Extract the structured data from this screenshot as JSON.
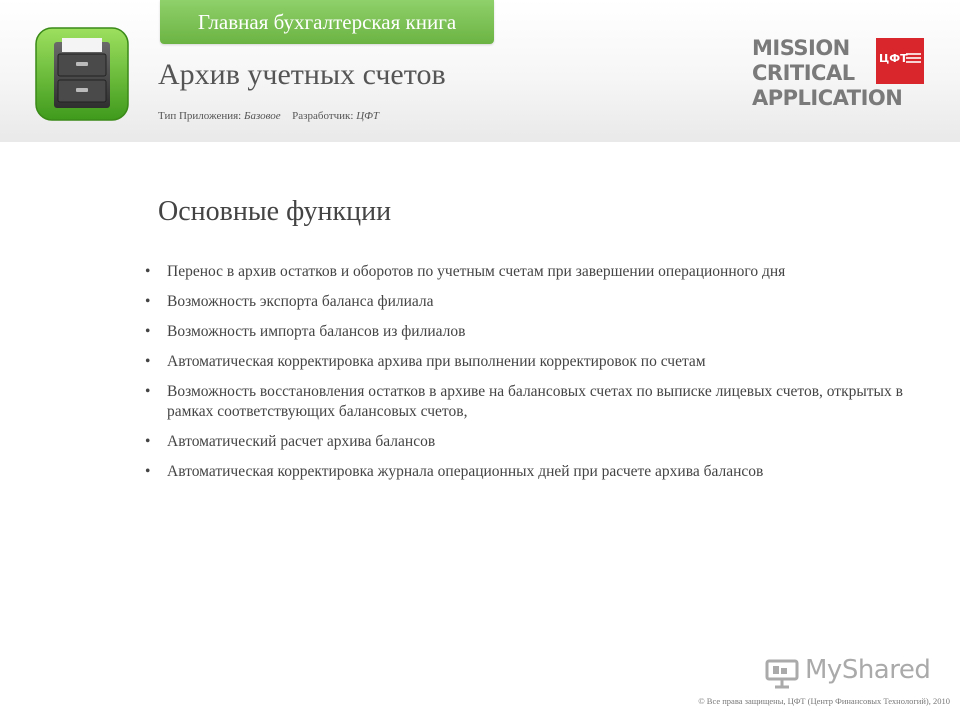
{
  "header": {
    "category_tab": "Главная бухгалтерская книга",
    "app_title": "Архив учетных счетов",
    "meta": {
      "type_label": "Тип Приложения:",
      "type_value": "Базовое",
      "developer_label": "Разработчик:",
      "developer_value": "ЦФТ"
    },
    "brand": {
      "line1": "MISSION",
      "line2": "CRITICAL",
      "line3": "APPLICATION",
      "logo_abbr": "ЦФТ",
      "logo_color": "#d9262c"
    },
    "accent_color": "#6bb443"
  },
  "main": {
    "heading": "Основные функции",
    "features": [
      "Перенос в архив остатков и оборотов по учетным счетам при завершении операционного дня",
      "Возможность экспорта баланса филиала",
      "Возможность импорта балансов из филиалов",
      "Автоматическая корректировка архива при выполнении корректировок по счетам",
      "Возможность восстановления остатков в архиве на балансовых счетах по выписке лицевых счетов, открытых в рамках соответствующих балансовых счетов,",
      "Автоматический расчет архива балансов",
      "Автоматическая корректировка журнала операционных дней при расчете архива балансов"
    ],
    "bullet_glyph": "•"
  },
  "watermark": {
    "text": "MyShared",
    "icon": "projector-icon"
  },
  "footer": {
    "copyright": "© Все права защищены, ЦФТ (Центр Финансовых Технологий), 2010"
  }
}
